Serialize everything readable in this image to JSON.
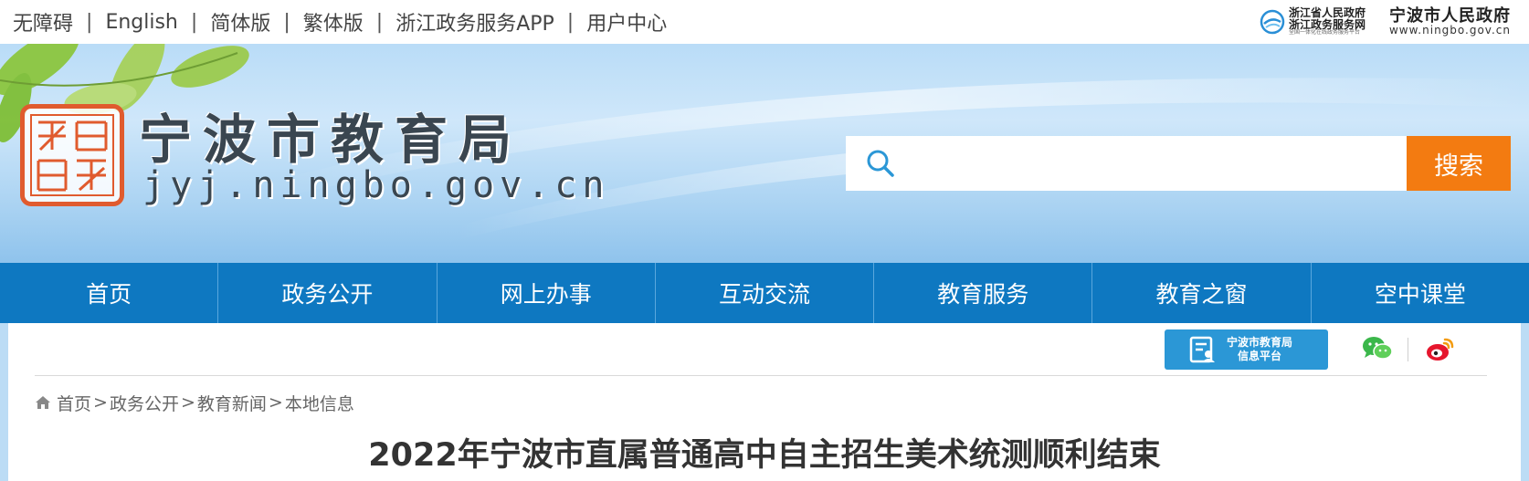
{
  "topbar": {
    "links": [
      "无障碍",
      "English",
      "简体版",
      "繁体版",
      "浙江政务服务APP",
      "用户中心"
    ],
    "separator": "|"
  },
  "gov_logos": {
    "zhejiang": {
      "line1": "浙江省人民政府",
      "line2": "浙江政务服务网",
      "line3": "全国一体化在线政务服务平台"
    },
    "ningbo": {
      "name": "宁波市人民政府",
      "url": "www.ningbo.gov.cn"
    }
  },
  "header": {
    "title": "宁波市教育局",
    "domain": "jyj.ningbo.gov.cn"
  },
  "search": {
    "placeholder": "",
    "button_label": "搜索"
  },
  "nav": {
    "items": [
      "首页",
      "政务公开",
      "网上办事",
      "互动交流",
      "教育服务",
      "教育之窗",
      "空中课堂"
    ]
  },
  "platform": {
    "line1": "宁波市教育局",
    "line2": "信息平台"
  },
  "breadcrumb": {
    "items": [
      "首页",
      "政务公开",
      "教育新闻",
      "本地信息"
    ],
    "separator": ">"
  },
  "article": {
    "title": "2022年宁波市直属普通高中自主招生美术统测顺利结束"
  },
  "colors": {
    "nav_bg": "#0e78c1",
    "search_button": "#f37b11",
    "seal": "#e05b2e",
    "platform_button": "#2b97d6"
  }
}
